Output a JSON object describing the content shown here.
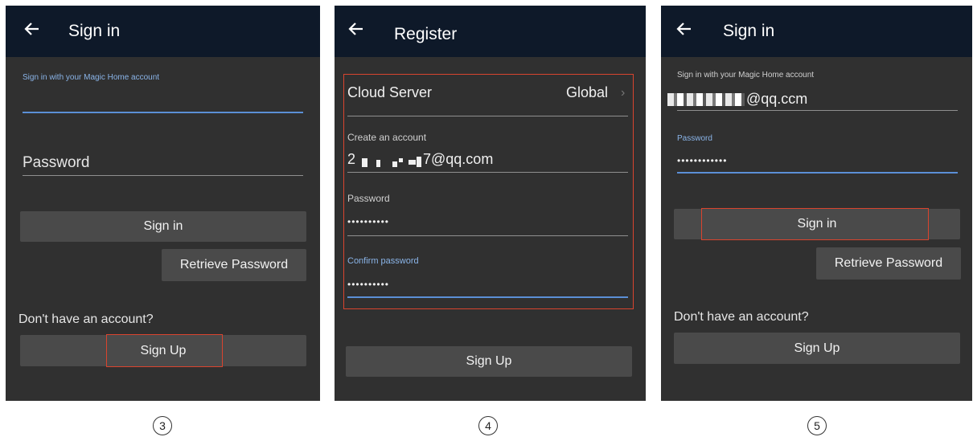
{
  "screen3": {
    "title": "Sign in",
    "account_hint": "Sign in with your Magic Home account",
    "password_placeholder": "Password",
    "sign_in": "Sign in",
    "retrieve_password": "Retrieve Password",
    "no_account": "Don't have an account?",
    "sign_up": "Sign Up",
    "step": "3"
  },
  "screen4": {
    "title": "Register",
    "cloud_server_label": "Cloud Server",
    "cloud_server_value": "Global",
    "create_account_label": "Create an account",
    "account_suffix": "7@qq.com",
    "account_prefix": "2",
    "password_label": "Password",
    "password_value": "••••••••••",
    "confirm_label": "Confirm password",
    "confirm_value": "••••••••••",
    "sign_up": "Sign Up",
    "step": "4"
  },
  "screen5": {
    "title": "Sign in",
    "account_hint": "Sign in with your Magic Home account",
    "account_suffix": "@qq.ccm",
    "password_label": "Password",
    "password_value": "••••••••••••",
    "sign_in": "Sign in",
    "retrieve_password": "Retrieve Password",
    "no_account": "Don't have an account?",
    "sign_up": "Sign Up",
    "step": "5"
  },
  "colors": {
    "appbar": "#0e1929",
    "screen_bg": "#303030",
    "button_bg": "#4a4a4a",
    "highlight": "#d9442e",
    "focus_line": "#5b8fd6"
  },
  "icons": [
    "back-arrow-icon",
    "chevron-right-icon"
  ]
}
